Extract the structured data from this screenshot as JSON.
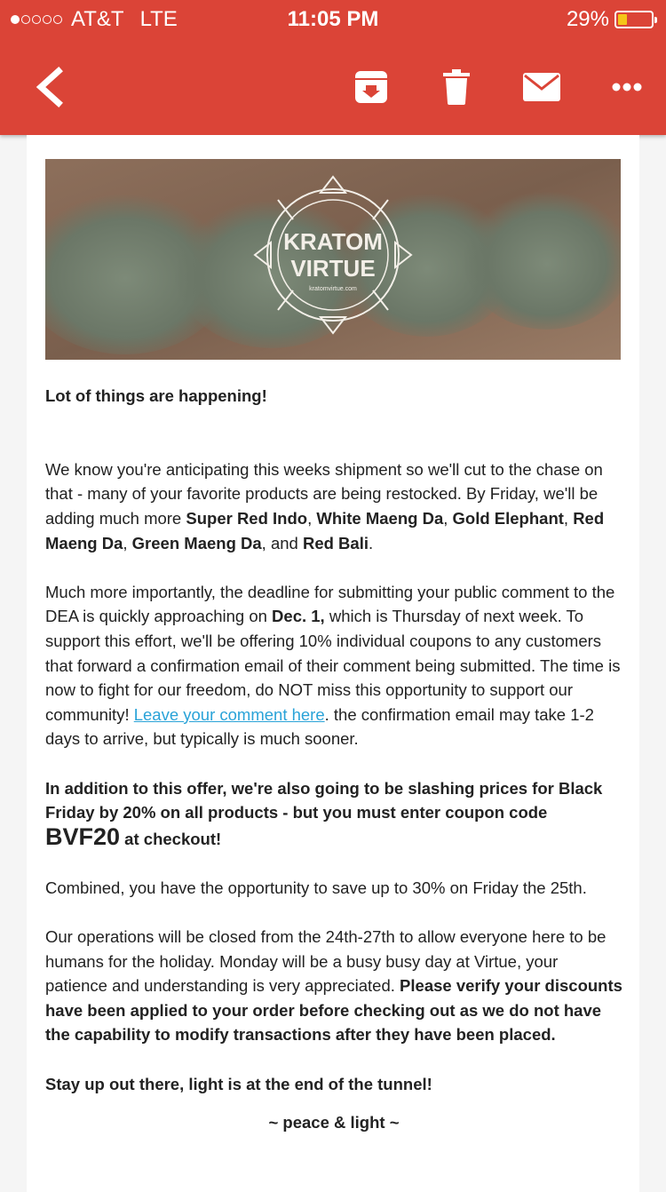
{
  "status_bar": {
    "carrier": "AT&T",
    "network": "LTE",
    "time": "11:05 PM",
    "battery": "29%",
    "signal_bars_filled": 1,
    "signal_bars_total": 5,
    "battery_level": 0.29
  },
  "toolbar": {
    "color": "#db4437",
    "icons": [
      "back-icon",
      "archive-icon",
      "trash-icon",
      "mail-icon",
      "more-icon"
    ]
  },
  "email": {
    "hero": {
      "logo_top": "KRATOM",
      "logo_bottom": "VIRTUE",
      "logo_small": "kratomvirtue.com"
    },
    "heading": "Lot of things are happening!",
    "p1": {
      "intro": "We know you're anticipating this weeks shipment so we'll cut to the chase on that - many of your favorite products are being restocked. By Friday, we'll be adding much more ",
      "product1": "Super Red Indo",
      "sep1": ", ",
      "product2": "White Maeng Da",
      "sep2": ", ",
      "product3": "Gold Elephant",
      "sep3": ", ",
      "product4": "Red Maeng Da",
      "sep4": ", ",
      "product5": "Green Maeng Da",
      "sep5": ", and ",
      "product6": "Red Bali",
      "end": "."
    },
    "p2": {
      "part1": "Much more importantly, the deadline for submitting your public comment to the DEA is quickly approaching on ",
      "date": "Dec. 1,",
      "part2": " which is Thursday of next week. To support this effort, we'll be offering 10% individual coupons to any customers that forward a confirmation email of their comment being submitted. The time is now to fight for our freedom, do NOT miss this opportunity to support our community! ",
      "link": "Leave your comment here",
      "part3": ". the confirmation email may take 1-2 days to arrive, but typically is much sooner.",
      "link_color": "#2aa3d8"
    },
    "p3": {
      "part1": "In addition to this offer, we're also going to be slashing prices for Black Friday by 20% on all products -  but you must enter coupon code ",
      "code": "BVF20",
      "part2": " at checkout!"
    },
    "p4": "Combined, you have the opportunity to save up to 30% on Friday the 25th.",
    "p5": {
      "part1": "Our operations will be closed from the 24th-27th to allow everyone here to be humans for the holiday. Monday will be a busy busy day at Virtue, your patience and understanding is very appreciated. ",
      "bold": "Please verify your discounts have been applied to your order before checking out as we do not have the capability to modify transactions after they have been placed."
    },
    "p6": "Stay up out there, light is at the end of the tunnel!",
    "signoff": "~ peace & light ~"
  }
}
